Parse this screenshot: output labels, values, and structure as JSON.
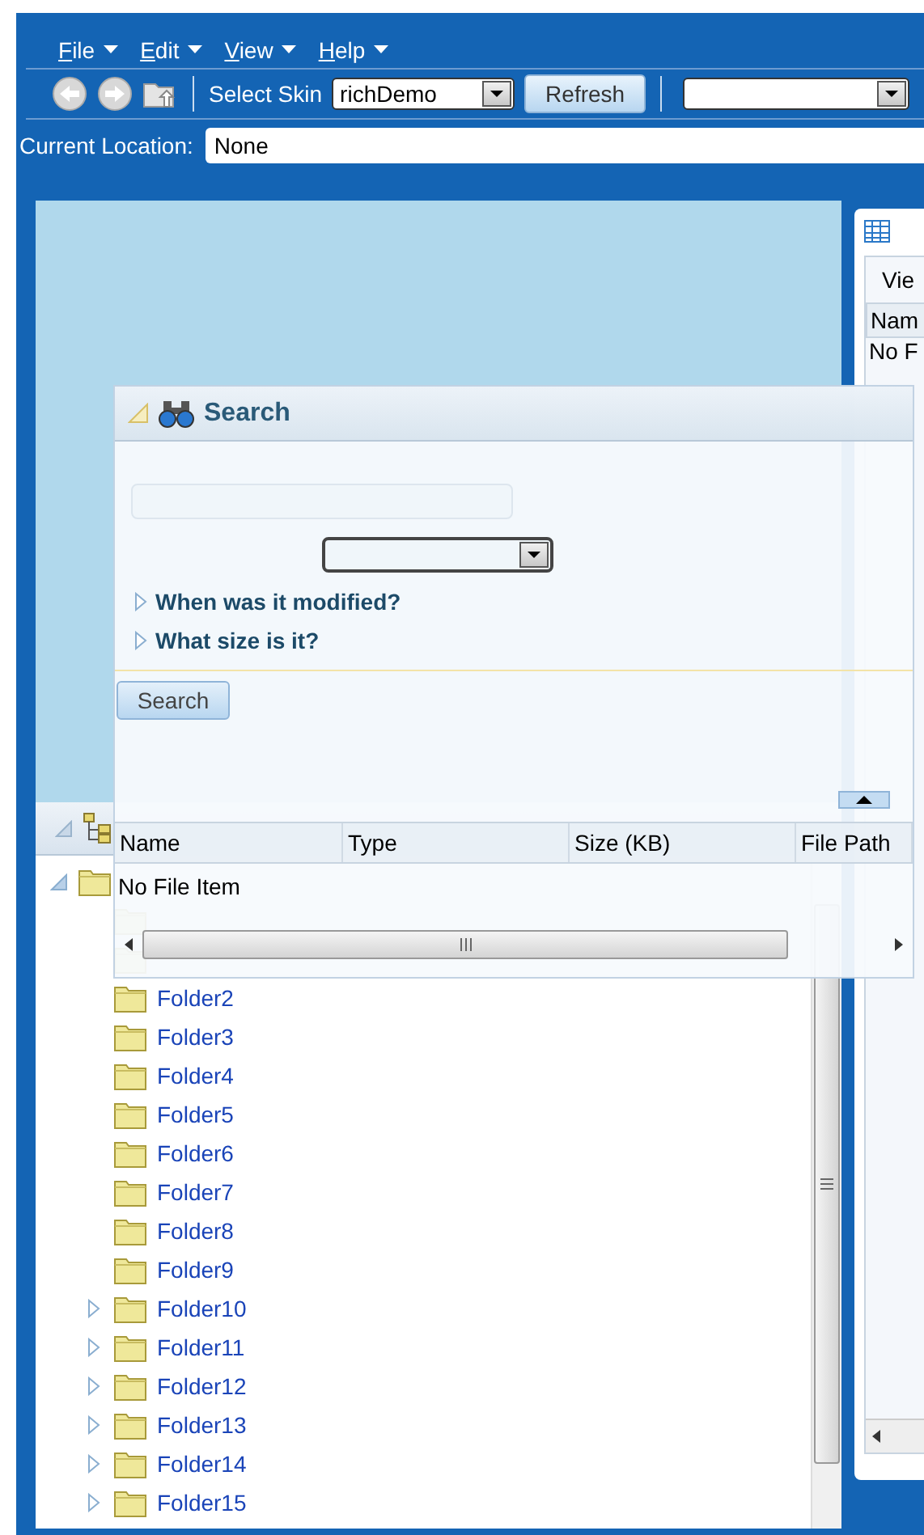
{
  "menu": [
    {
      "label": "File"
    },
    {
      "label": "Edit"
    },
    {
      "label": "View"
    },
    {
      "label": "Help"
    }
  ],
  "toolbar": {
    "skin_label": "Select Skin",
    "skin_value": "richDemo",
    "refresh_button": "Refresh"
  },
  "location": {
    "label": "Current Location:",
    "value": "None"
  },
  "folders_panel": {
    "tree": [
      {
        "expanded": true,
        "children": [
          {
            "expandable": false
          },
          {
            "expandable": false
          },
          {
            "label": "Folder2",
            "expandable": false
          },
          {
            "label": "Folder3",
            "expandable": false
          },
          {
            "label": "Folder4",
            "expandable": false
          },
          {
            "label": "Folder5",
            "expandable": false
          },
          {
            "label": "Folder6",
            "expandable": false
          },
          {
            "label": "Folder7",
            "expandable": false
          },
          {
            "label": "Folder8",
            "expandable": false
          },
          {
            "label": "Folder9",
            "expandable": false
          },
          {
            "label": "Folder10",
            "expandable": true
          },
          {
            "label": "Folder11",
            "expandable": true
          },
          {
            "label": "Folder12",
            "expandable": true
          },
          {
            "label": "Folder13",
            "expandable": true
          },
          {
            "label": "Folder14",
            "expandable": true
          },
          {
            "label": "Folder15",
            "expandable": true
          }
        ]
      }
    ]
  },
  "right_panel": {
    "toolbar_text": "Vie",
    "column": "Nam",
    "empty_message": "No F"
  },
  "search_panel": {
    "title": "Search",
    "sections": [
      {
        "label": "When was it modified?",
        "expanded": false
      },
      {
        "label": "What size is it?",
        "expanded": false
      }
    ],
    "search_button": "Search",
    "table": {
      "columns": [
        "Name",
        "Type",
        "Size (KB)",
        "File Path"
      ],
      "empty_message": "No File Item"
    }
  }
}
